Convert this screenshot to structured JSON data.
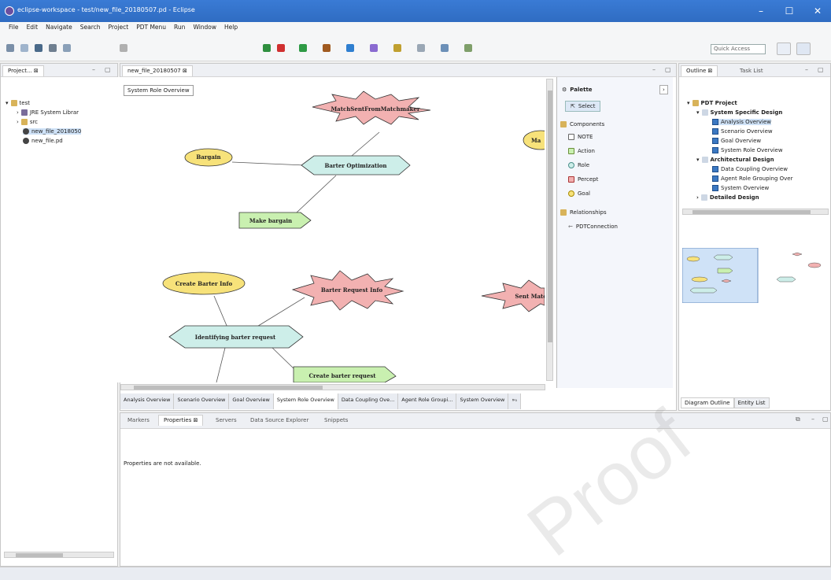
{
  "window": {
    "title": "eclipse-workspace - test/new_file_20180507.pd - Eclipse",
    "minimize": "–",
    "maximize": "☐",
    "close": "✕"
  },
  "menu": [
    "File",
    "Edit",
    "Navigate",
    "Search",
    "Project",
    "PDT Menu",
    "Run",
    "Window",
    "Help"
  ],
  "toolbar": {
    "quick_access": "Quick Access"
  },
  "project_explorer": {
    "tab": "Project... ⊠",
    "tree": [
      "test",
      "JRE System Librar",
      "src",
      "new_file_2018050",
      "new_file.pd"
    ]
  },
  "editor": {
    "tab": "new_file_20180507 ⊠",
    "diagram_label": "System Role Overview",
    "nodes": {
      "percept1": "MatchSentFromMatchmaker",
      "action_optim": "Barter Optimization",
      "goal_bargain": "Bargain",
      "make_bargain": "Make bargain",
      "goal_partial": "Ma",
      "create_info": "Create Barter Info",
      "barter_req_info": "Barter Request Info",
      "sent_match": "Sent Match",
      "identifying": "Identifying barter request",
      "create_req": "Create barter request"
    },
    "bottom_tabs": [
      "Analysis Overview",
      "Scenario Overview",
      "Goal Overview",
      "System Role Overview",
      "Data Coupling Ove...",
      "Agent Role Groupi...",
      "System Overview",
      "»₅"
    ]
  },
  "palette": {
    "title": "Palette",
    "select": "Select",
    "components_header": "Components",
    "components": [
      "NOTE",
      "Action",
      "Role",
      "Percept",
      "Goal"
    ],
    "relationships_header": "Relationships",
    "relationships": [
      "PDTConnection"
    ]
  },
  "outline": {
    "tab_outline": "Outline ⊠",
    "tab_task": "Task List",
    "tree": {
      "root": "PDT Project",
      "ssd": "System Specific Design",
      "ssd_items": [
        "Analysis Overview",
        "Scenario Overview",
        "Goal Overview",
        "System Role Overview"
      ],
      "ad": "Architectural Design",
      "ad_items": [
        "Data Coupling Overview",
        "Agent Role Grouping Over",
        "System Overview"
      ],
      "dd": "Detailed Design"
    },
    "bottom_tabs": [
      "Diagram Outline",
      "Entity List"
    ]
  },
  "bottom_panel": {
    "tabs": [
      "Markers",
      "Properties ⊠",
      "Servers",
      "Data Source Explorer",
      "Snippets"
    ],
    "message": "Properties are not available."
  },
  "watermark": "Proof",
  "colors": {
    "action": "#cdeee9",
    "goal": "#f7e27a",
    "percept": "#f2b1b1",
    "make": "#c9f0b0"
  }
}
